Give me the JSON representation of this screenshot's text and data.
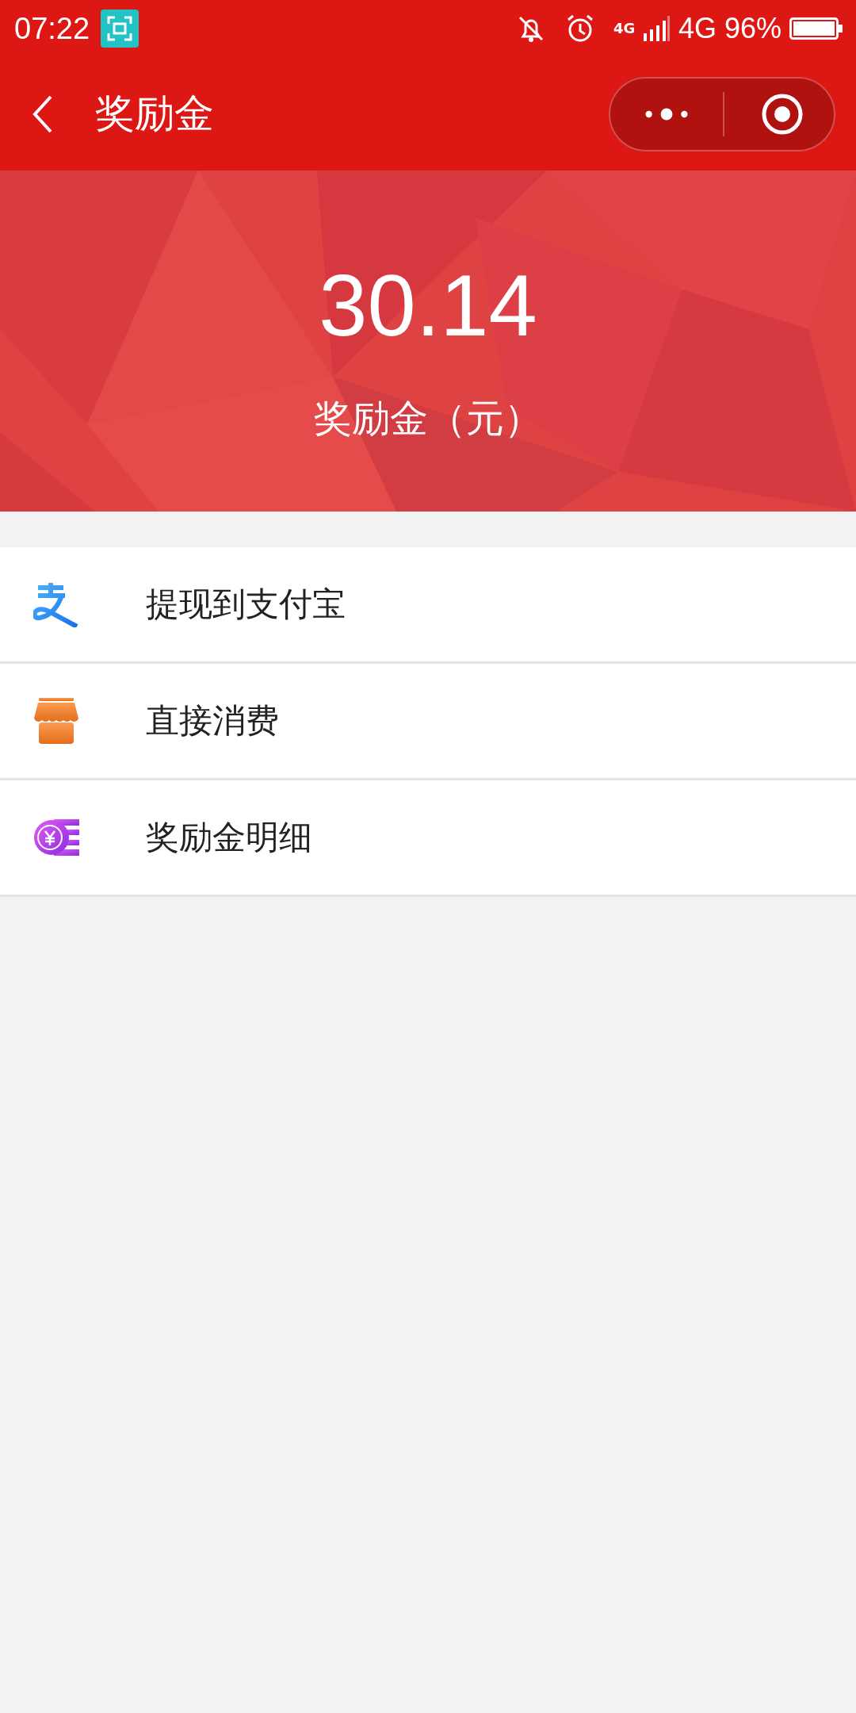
{
  "status_bar": {
    "time": "07:22",
    "data_label": "4G",
    "network": "4G",
    "battery": "96%"
  },
  "header": {
    "title": "奖励金"
  },
  "balance": {
    "amount": "30.14",
    "label": "奖励金（元）"
  },
  "menu": [
    {
      "label": "提现到支付宝",
      "kind": "alipay"
    },
    {
      "label": "直接消费",
      "kind": "shop"
    },
    {
      "label": "奖励金明细",
      "kind": "detail"
    }
  ]
}
